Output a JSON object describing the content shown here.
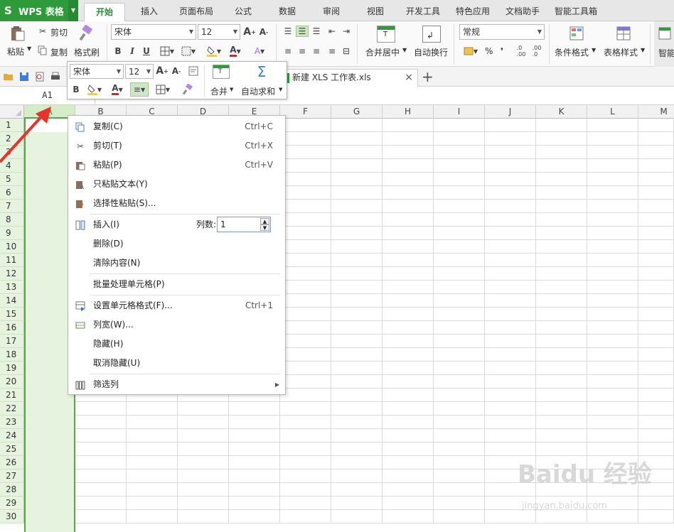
{
  "app": {
    "name": "WPS 表格"
  },
  "tabs": [
    "开始",
    "插入",
    "页面布局",
    "公式",
    "数据",
    "审阅",
    "视图",
    "开发工具",
    "特色应用",
    "文档助手",
    "智能工具箱"
  ],
  "ribbon": {
    "paste": "粘贴",
    "cut": "剪切",
    "copy": "复制",
    "format_painter": "格式刷",
    "font_name": "宋体",
    "font_size": "12",
    "merge_center": "合并居中",
    "auto_wrap": "自动换行",
    "number_format": "常规",
    "percent": "%",
    "comma": "❜",
    "cond_format": "条件格式",
    "table_style": "表格样式",
    "smart": "智能"
  },
  "document": {
    "tab_title": "新建 XLS 工作表.xls"
  },
  "namebox": "A1",
  "mini_toolbar": {
    "font_name": "宋体",
    "font_size": "12",
    "merge": "合并",
    "autosum": "自动求和"
  },
  "columns": [
    "A",
    "B",
    "C",
    "D",
    "E",
    "F",
    "G",
    "H",
    "I",
    "J",
    "K",
    "L",
    "M"
  ],
  "rows": [
    "1",
    "2",
    "3",
    "4",
    "5",
    "6",
    "7",
    "8",
    "9",
    "10",
    "11",
    "12",
    "13",
    "14",
    "15",
    "16",
    "17",
    "18",
    "19",
    "20",
    "21",
    "22",
    "23",
    "24",
    "25",
    "26",
    "27",
    "28",
    "29",
    "30"
  ],
  "context_menu": {
    "copy": {
      "label": "复制(C)",
      "shortcut": "Ctrl+C"
    },
    "cut": {
      "label": "剪切(T)",
      "shortcut": "Ctrl+X"
    },
    "paste": {
      "label": "粘贴(P)",
      "shortcut": "Ctrl+V"
    },
    "paste_text": {
      "label": "只粘贴文本(Y)"
    },
    "paste_special": {
      "label": "选择性粘贴(S)..."
    },
    "insert": {
      "label": "插入(I)",
      "count_label": "列数:",
      "count_value": "1"
    },
    "delete": {
      "label": "删除(D)"
    },
    "clear": {
      "label": "清除内容(N)"
    },
    "batch": {
      "label": "批量处理单元格(P)"
    },
    "format_cells": {
      "label": "设置单元格格式(F)...",
      "shortcut": "Ctrl+1"
    },
    "col_width": {
      "label": "列宽(W)..."
    },
    "hide": {
      "label": "隐藏(H)"
    },
    "unhide": {
      "label": "取消隐藏(U)"
    },
    "filter_col": {
      "label": "筛选列"
    }
  },
  "watermark": {
    "main": "Baidu 经验",
    "sub": "jingyan.baidu.com"
  },
  "colors": {
    "wps_green": "#2f9a3a",
    "selection_fill": "#e6f3de",
    "annotation_red": "#e8322c"
  }
}
